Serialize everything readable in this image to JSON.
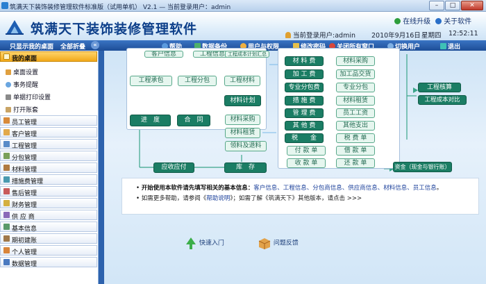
{
  "window": {
    "title": "筑满天下装饰装修管理软件标准版（试用单机） V2.1 — 当前登录用户：admin",
    "min": "–",
    "max": "□",
    "close": "✕"
  },
  "header": {
    "app_title": "筑满天下装饰装修管理软件",
    "upgrade": "在线升级",
    "about": "关于软件",
    "user_label": "当前登录用户:admin",
    "date": "2010年9月16日",
    "weekday": "星期四",
    "time": "12:52:11"
  },
  "toolbar": {
    "show_desktop": "只显示我的桌面",
    "collapse_all": "全部折叠",
    "help": "帮助",
    "backup": "数据备份",
    "users": "用户与权限",
    "password": "修改密码",
    "close_windows": "关闭所有窗口",
    "switch_user": "切换用户",
    "exit": "退出"
  },
  "sidebar": {
    "desktop": {
      "label": "我的桌面",
      "items": [
        "桌面设置",
        "事务提醒",
        "单据打印设置",
        "打开账套"
      ]
    },
    "sections": [
      "员工管理",
      "客户管理",
      "工程管理",
      "分包管理",
      "材料管理",
      "措施费管理",
      "售后管理",
      "财务管理",
      "供 应 商",
      "基本信息",
      "期初建账",
      "个人管理",
      "数据管理"
    ]
  },
  "diagram": {
    "top_cut": [
      "客户信息",
      "工程信息",
      "工程成本计划汇总"
    ],
    "proj_pkg": "工程承包",
    "subcontract": "工程分包",
    "eng_material": "工程材料",
    "progress": "进　度",
    "contract": "合　同",
    "material_plan": "材料计划",
    "mat_purchase2": "材料采购",
    "mat_rent2": "材料租赁",
    "receive": "领料及退料",
    "payable": "应收应付",
    "stock": "库　存",
    "costs": [
      "材 料 费",
      "加 工 费",
      "专业分包费",
      "措 施 费",
      "管 理 费",
      "其 他 费",
      "税　　金"
    ],
    "cost_right": [
      "材料采购",
      "加工品交货",
      "专业分包",
      "材料租赁",
      "员工工资",
      "其他支出",
      "税 费 单"
    ],
    "pay": [
      "付 款 单",
      "收 款 单"
    ],
    "debt": [
      "借 款 单",
      "还 款 单"
    ],
    "settle": "工程核算",
    "cost_cmp": "工程成本对比",
    "funds": "资金（现金与银行账）"
  },
  "info": {
    "line1_lead": "开始使用本软件请先填写相关的基本信息：",
    "line1_items": "客户信息、工程信息、分包商信息、供应商信息、材料信息、员工信息",
    "line1_end": "。",
    "line2_a": "如需更多帮助，请参阅《",
    "line2_help": "帮助说明",
    "line2_b": "》；如需了解《筑满天下》其他版本，请点击 >>>"
  },
  "bottom": {
    "quick_start": "快速入门",
    "feedback": "问题反馈"
  },
  "colors": {
    "accent": "#1d4d96",
    "dark_green": "#1b7d64",
    "light_green": "#e6f6ef",
    "highlight": "#f2a818"
  }
}
